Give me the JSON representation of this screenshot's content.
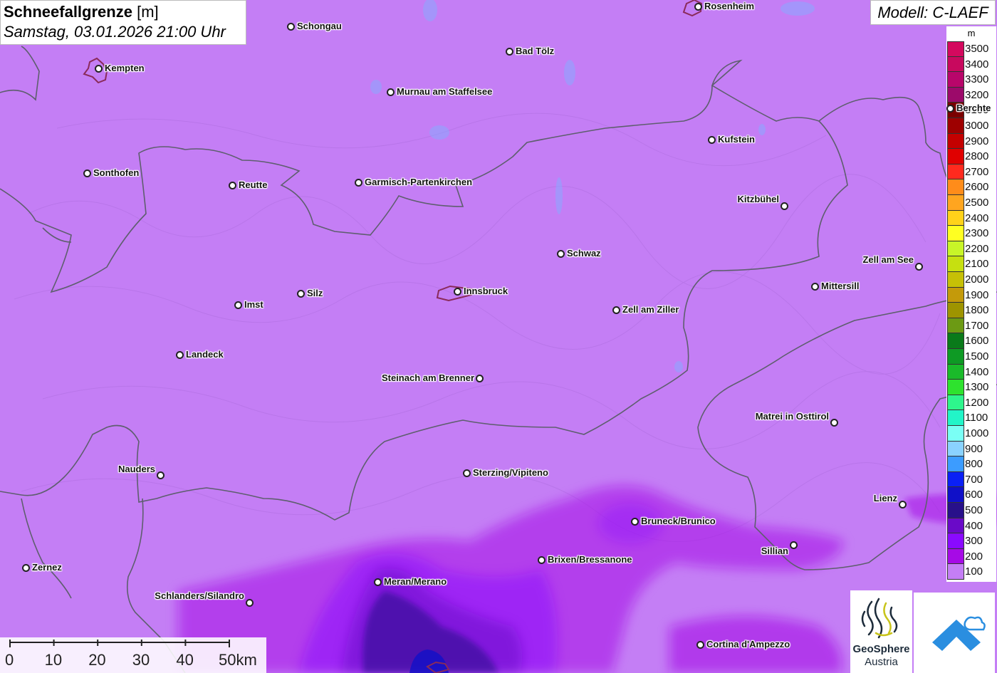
{
  "title": {
    "main": "Schneefallgrenze",
    "unit": "[m]",
    "datetime": "Samstag, 03.01.2026 21:00 Uhr"
  },
  "model": "Modell: C-LAEF",
  "legend": {
    "unit": "m",
    "items": [
      {
        "label": "3500",
        "color": "#d4095e"
      },
      {
        "label": "3400",
        "color": "#c8095e"
      },
      {
        "label": "3300",
        "color": "#b8066a"
      },
      {
        "label": "3200",
        "color": "#9c0a6a"
      },
      {
        "label": "3100",
        "color": "#7a0000"
      },
      {
        "label": "3000",
        "color": "#9e0000"
      },
      {
        "label": "2900",
        "color": "#c40000"
      },
      {
        "label": "2800",
        "color": "#e00000"
      },
      {
        "label": "2700",
        "color": "#ff2a1e"
      },
      {
        "label": "2600",
        "color": "#ff8c1a"
      },
      {
        "label": "2500",
        "color": "#ffa51f"
      },
      {
        "label": "2400",
        "color": "#ffd21a"
      },
      {
        "label": "2300",
        "color": "#ffff22"
      },
      {
        "label": "2200",
        "color": "#c8f528"
      },
      {
        "label": "2100",
        "color": "#c6e010"
      },
      {
        "label": "2000",
        "color": "#c6c006"
      },
      {
        "label": "1900",
        "color": "#c49a0a"
      },
      {
        "label": "1800",
        "color": "#9e9400"
      },
      {
        "label": "1700",
        "color": "#6c9a14"
      },
      {
        "label": "1600",
        "color": "#0a7a1a"
      },
      {
        "label": "1500",
        "color": "#0e9a24"
      },
      {
        "label": "1400",
        "color": "#1aba2a"
      },
      {
        "label": "1300",
        "color": "#2ee22e"
      },
      {
        "label": "1200",
        "color": "#2ef58c"
      },
      {
        "label": "1100",
        "color": "#22f5c8"
      },
      {
        "label": "1000",
        "color": "#7afff5"
      },
      {
        "label": "900",
        "color": "#8ad2ff"
      },
      {
        "label": "800",
        "color": "#3c9cff"
      },
      {
        "label": "700",
        "color": "#0a20f5"
      },
      {
        "label": "600",
        "color": "#1010c8"
      },
      {
        "label": "500",
        "color": "#28108a"
      },
      {
        "label": "400",
        "color": "#6a0ac8"
      },
      {
        "label": "300",
        "color": "#8a0aff"
      },
      {
        "label": "200",
        "color": "#a60ae6"
      },
      {
        "label": "100",
        "color": "#c47ef5"
      }
    ]
  },
  "cities": [
    {
      "name": "Rosenheim",
      "side": "right"
    },
    {
      "name": "Schongau",
      "side": "right"
    },
    {
      "name": "Bad Tölz",
      "side": "right"
    },
    {
      "name": "Kempten",
      "side": "right"
    },
    {
      "name": "Murnau am Staffelsee",
      "side": "right"
    },
    {
      "name": "Berchte",
      "side": "right"
    },
    {
      "name": "Kufstein",
      "side": "right"
    },
    {
      "name": "Sonthofen",
      "side": "right"
    },
    {
      "name": "Reutte",
      "side": "right"
    },
    {
      "name": "Garmisch-Partenkirchen",
      "side": "right"
    },
    {
      "name": "Kitzbühel",
      "side": "left"
    },
    {
      "name": "Schwaz",
      "side": "right"
    },
    {
      "name": "Zell am See",
      "side": "left"
    },
    {
      "name": "Mittersill",
      "side": "right"
    },
    {
      "name": "Innsbruck",
      "side": "right"
    },
    {
      "name": "Silz",
      "side": "right"
    },
    {
      "name": "Imst",
      "side": "right"
    },
    {
      "name": "Zell am Ziller",
      "side": "right"
    },
    {
      "name": "Landeck",
      "side": "right"
    },
    {
      "name": "Steinach am Brenner",
      "side": "left"
    },
    {
      "name": "Matrei in Osttirol",
      "side": "left"
    },
    {
      "name": "Nauders",
      "side": "left"
    },
    {
      "name": "Sterzing/Vipiteno",
      "side": "right"
    },
    {
      "name": "Lienz",
      "side": "left"
    },
    {
      "name": "Bruneck/Brunico",
      "side": "right"
    },
    {
      "name": "Sillian",
      "side": "left"
    },
    {
      "name": "Brixen/Bressanone",
      "side": "right"
    },
    {
      "name": "Zernez",
      "side": "right"
    },
    {
      "name": "Meran/Merano",
      "side": "right"
    },
    {
      "name": "Schlanders/Silandro",
      "side": "left"
    },
    {
      "name": "Cortina d'Ampezzo",
      "side": "right"
    }
  ],
  "scale_bar": {
    "labels": [
      "0",
      "10",
      "20",
      "30",
      "40",
      "50km"
    ]
  },
  "logos": {
    "geosphere_name": "GeoSphere",
    "geosphere_sub": "Austria"
  },
  "colors": {
    "background": "#c47ef5",
    "border_line": "#5e5e6e",
    "city_outline": "#8a2a5a"
  }
}
